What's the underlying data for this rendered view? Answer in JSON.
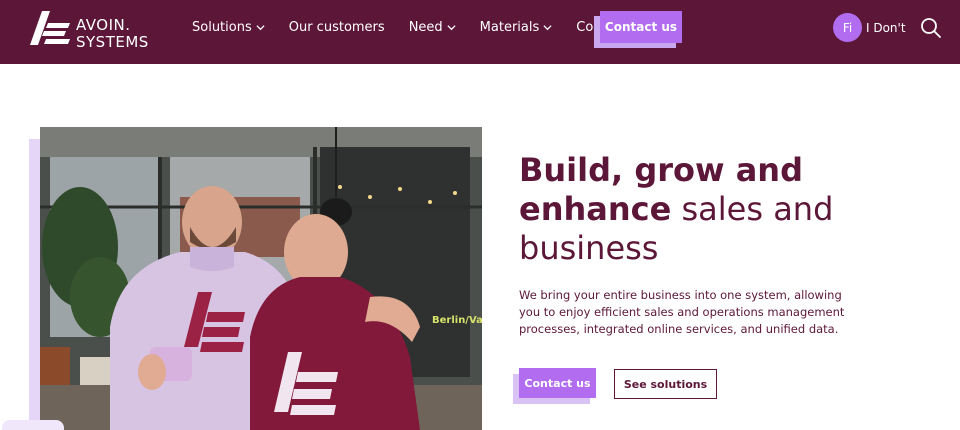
{
  "brand": {
    "line1": "AVOIN.",
    "line2": "SYSTEMS"
  },
  "nav": {
    "items": [
      {
        "label": "Solutions",
        "has_dropdown": true
      },
      {
        "label": "Our customers",
        "has_dropdown": false
      },
      {
        "label": "Need",
        "has_dropdown": true
      },
      {
        "label": "Materials",
        "has_dropdown": true
      },
      {
        "label": "Company",
        "has_dropdown": true
      }
    ],
    "contact_label": "Contact us"
  },
  "user": {
    "initials": "Fi",
    "name": "I Don't"
  },
  "hero": {
    "headline_bold": "Build, grow and enhance",
    "headline_light": "sales and business",
    "description": "We bring your entire business into one system, allowing you to enjoy efficient sales and operations management processes, integrated online services, and unified data.",
    "primary_cta": "Contact us",
    "secondary_cta": "See solutions",
    "photo_sign_text": "Berlin/Va"
  },
  "colors": {
    "header_bg": "#5c1738",
    "accent": "#b26cf0",
    "accent_light": "#d9c3f5",
    "text": "#5c1738"
  },
  "icons": [
    "avoin-logo-icon",
    "chevron-down-icon",
    "search-icon"
  ]
}
